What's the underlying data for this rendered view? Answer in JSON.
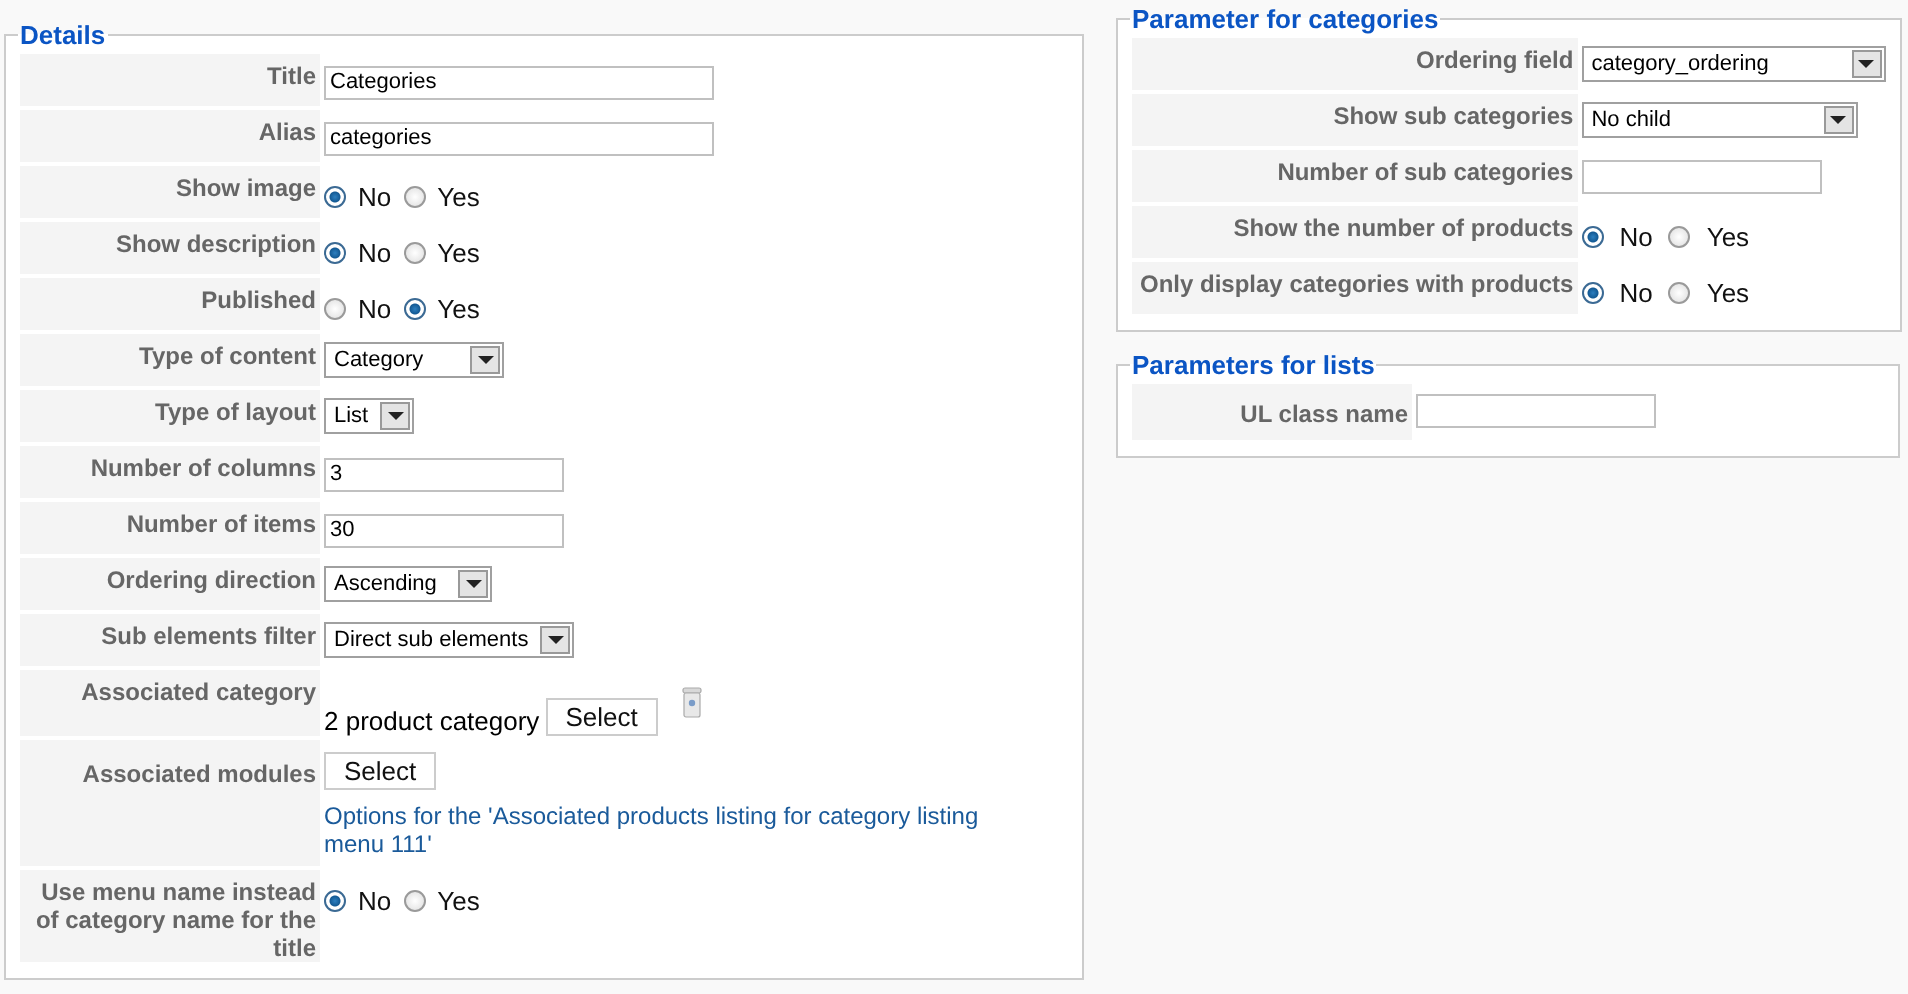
{
  "sections": [
    {
      "legend": "Details",
      "rows": [
        {
          "label": "Title",
          "kind": "text",
          "value": "Categories"
        },
        {
          "label": "Alias",
          "kind": "text",
          "value": "categories"
        },
        {
          "label": "Show image",
          "kind": "radio",
          "options": [
            {
              "label": "No",
              "selected": true
            },
            {
              "label": "Yes",
              "selected": false
            }
          ]
        },
        {
          "label": "Show description",
          "kind": "radio",
          "options": [
            {
              "label": "No",
              "selected": true
            },
            {
              "label": "Yes",
              "selected": false
            }
          ]
        },
        {
          "label": "Published",
          "kind": "radio",
          "options": [
            {
              "label": "No",
              "selected": false
            },
            {
              "label": "Yes",
              "selected": true
            }
          ]
        },
        {
          "label": "Type of content",
          "kind": "select",
          "value": "Category"
        },
        {
          "label": "Type of layout",
          "kind": "select",
          "value": "List"
        },
        {
          "label": "Number of columns",
          "kind": "text",
          "value": "3"
        },
        {
          "label": "Number of items",
          "kind": "text",
          "value": "30"
        },
        {
          "label": "Ordering direction",
          "kind": "select",
          "value": "Ascending"
        },
        {
          "label": "Sub elements filter",
          "kind": "select",
          "value": "Direct sub elements"
        },
        {
          "label": "Associated category",
          "kind": "picker",
          "value": "2 product category",
          "button": "Select"
        },
        {
          "label": "Associated modules",
          "kind": "modules",
          "button": "Select",
          "link": "Options for the 'Associated products listing for category listing menu 111'"
        },
        {
          "label": "Use menu name instead of category name for the title",
          "kind": "radio",
          "options": [
            {
              "label": "No",
              "selected": true
            },
            {
              "label": "Yes",
              "selected": false
            }
          ]
        }
      ]
    },
    {
      "legend": "Parameter for categories",
      "rows": [
        {
          "label": "Ordering field",
          "kind": "select",
          "value": "category_ordering"
        },
        {
          "label": "Show sub categories",
          "kind": "select",
          "value": "No child"
        },
        {
          "label": "Number of sub categories",
          "kind": "text",
          "value": ""
        },
        {
          "label": "Show the number of products",
          "kind": "radio",
          "options": [
            {
              "label": "No",
              "selected": true
            },
            {
              "label": "Yes",
              "selected": false
            }
          ]
        },
        {
          "label": "Only display categories with products",
          "kind": "radio",
          "options": [
            {
              "label": "No",
              "selected": true
            },
            {
              "label": "Yes",
              "selected": false
            }
          ]
        }
      ]
    },
    {
      "legend": "Parameters for lists",
      "rows": [
        {
          "label": "UL class name",
          "kind": "text",
          "value": ""
        }
      ]
    }
  ]
}
